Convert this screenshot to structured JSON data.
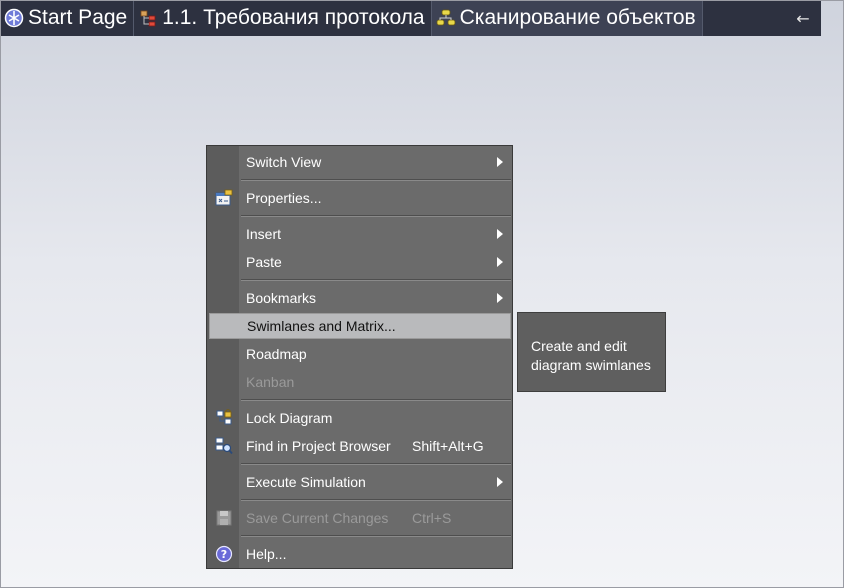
{
  "tabs": [
    {
      "label": "Start Page",
      "icon": "start-page-icon"
    },
    {
      "label": "1.1. Требования протокола",
      "icon": "requirements-diagram-icon"
    },
    {
      "label": "Сканирование объектов",
      "icon": "activity-diagram-icon"
    }
  ],
  "tab_overflow_icon": "arrow-left-icon",
  "menu": {
    "switch_view": "Switch View",
    "properties": "Properties...",
    "insert": "Insert",
    "paste": "Paste",
    "bookmarks": "Bookmarks",
    "swimlanes": "Swimlanes and Matrix...",
    "roadmap": "Roadmap",
    "kanban": "Kanban",
    "lock_diagram": "Lock Diagram",
    "find_in_browser": "Find in Project Browser",
    "find_in_browser_shortcut": "Shift+Alt+G",
    "execute_simulation": "Execute Simulation",
    "save_changes": "Save Current Changes",
    "save_changes_shortcut": "Ctrl+S",
    "help": "Help..."
  },
  "tooltip": {
    "line1": "Create and edit",
    "line2": "diagram swimlanes"
  },
  "colors": {
    "tabbar": "#2d3140",
    "menu_bg": "#6b6b6b",
    "highlight": "#b9babc",
    "disabled_text": "#9a9a9a"
  }
}
